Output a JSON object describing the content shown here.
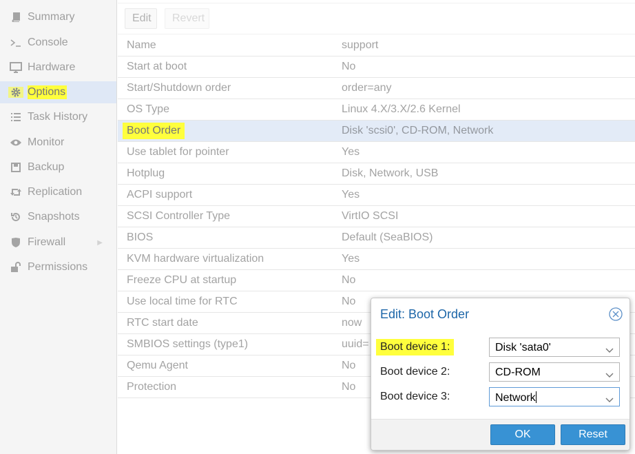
{
  "sidebar": {
    "items": [
      {
        "label": "Summary",
        "icon": "book-icon"
      },
      {
        "label": "Console",
        "icon": "terminal-icon"
      },
      {
        "label": "Hardware",
        "icon": "monitor-icon"
      },
      {
        "label": "Options",
        "icon": "gear-icon"
      },
      {
        "label": "Task History",
        "icon": "list-icon"
      },
      {
        "label": "Monitor",
        "icon": "eye-icon"
      },
      {
        "label": "Backup",
        "icon": "floppy-icon"
      },
      {
        "label": "Replication",
        "icon": "retweet-icon"
      },
      {
        "label": "Snapshots",
        "icon": "history-icon"
      },
      {
        "label": "Firewall",
        "icon": "shield-icon"
      },
      {
        "label": "Permissions",
        "icon": "unlock-icon"
      }
    ],
    "active": "Options"
  },
  "toolbar": {
    "edit_label": "Edit",
    "revert_label": "Revert"
  },
  "options": [
    {
      "key": "Name",
      "value": "support"
    },
    {
      "key": "Start at boot",
      "value": "No"
    },
    {
      "key": "Start/Shutdown order",
      "value": "order=any"
    },
    {
      "key": "OS Type",
      "value": "Linux 4.X/3.X/2.6 Kernel"
    },
    {
      "key": "Boot Order",
      "value": "Disk 'scsi0', CD-ROM, Network"
    },
    {
      "key": "Use tablet for pointer",
      "value": "Yes"
    },
    {
      "key": "Hotplug",
      "value": "Disk, Network, USB"
    },
    {
      "key": "ACPI support",
      "value": "Yes"
    },
    {
      "key": "SCSI Controller Type",
      "value": "VirtIO SCSI"
    },
    {
      "key": "BIOS",
      "value": "Default (SeaBIOS)"
    },
    {
      "key": "KVM hardware virtualization",
      "value": "Yes"
    },
    {
      "key": "Freeze CPU at startup",
      "value": "No"
    },
    {
      "key": "Use local time for RTC",
      "value": "No"
    },
    {
      "key": "RTC start date",
      "value": "now"
    },
    {
      "key": "SMBIOS settings (type1)",
      "value": "uuid="
    },
    {
      "key": "Qemu Agent",
      "value": "No"
    },
    {
      "key": "Protection",
      "value": "No"
    }
  ],
  "dialog": {
    "title": "Edit: Boot Order",
    "fields": [
      {
        "label": "Boot device 1:",
        "value": "Disk 'sata0'"
      },
      {
        "label": "Boot device 2:",
        "value": "CD-ROM"
      },
      {
        "label": "Boot device 3:",
        "value": "Network"
      }
    ],
    "ok_label": "OK",
    "reset_label": "Reset"
  },
  "colors": {
    "highlight": "#ffff3d",
    "dialog_title": "#1c66a8",
    "button": "#3892d4",
    "selected_row": "#e3ebf7"
  }
}
